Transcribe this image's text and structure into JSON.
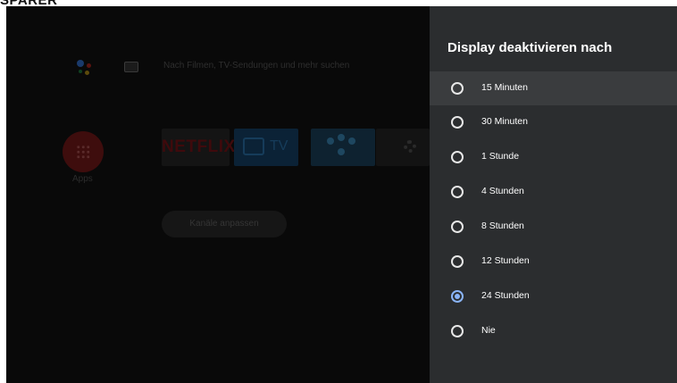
{
  "header": {
    "brand": "SPARER"
  },
  "home": {
    "search_hint": "Nach Filmen, TV-Sendungen und mehr suchen",
    "apps_label": "Apps",
    "netflix_label": "NETFLIX",
    "tv_label": "TV",
    "channels_button": "Kanäle anpassen"
  },
  "panel": {
    "title": "Display deaktivieren nach",
    "selected": "24 Stunden",
    "options": [
      {
        "label": "15 Minuten",
        "checked": false,
        "focused": true
      },
      {
        "label": "30 Minuten",
        "checked": false,
        "focused": false
      },
      {
        "label": "1 Stunde",
        "checked": false,
        "focused": false
      },
      {
        "label": "4 Stunden",
        "checked": false,
        "focused": false
      },
      {
        "label": "8 Stunden",
        "checked": false,
        "focused": false
      },
      {
        "label": "12 Stunden",
        "checked": false,
        "focused": false
      },
      {
        "label": "24 Stunden",
        "checked": true,
        "focused": false
      },
      {
        "label": "Nie",
        "checked": false,
        "focused": false
      }
    ]
  },
  "colors": {
    "accent": "#8ab4f8",
    "panel": "#2b2d2f",
    "focus": "#3a3c3e"
  },
  "icons": [
    "assistant-icon",
    "keyboard-icon",
    "apps-grid-icon",
    "tv-icon",
    "gear-icon"
  ]
}
